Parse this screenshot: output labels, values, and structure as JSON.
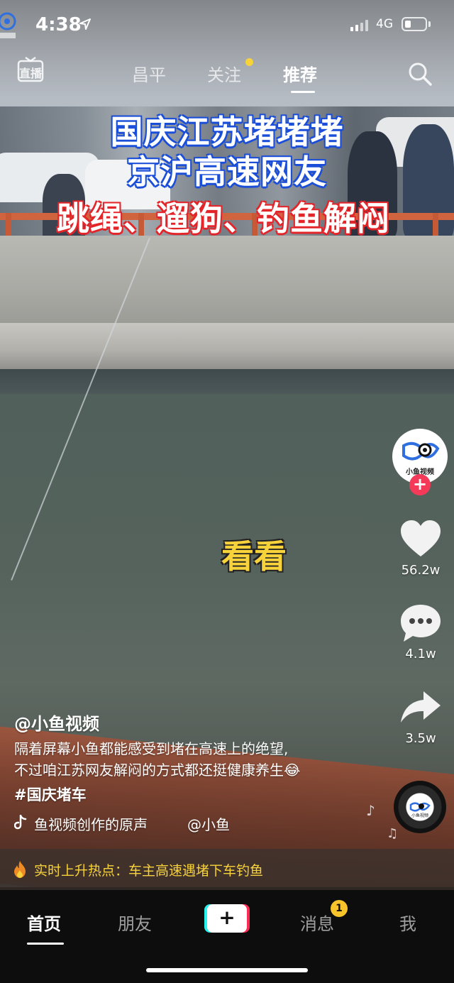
{
  "status_bar": {
    "time": "4:38",
    "network": "4G"
  },
  "watermark": {
    "text": "小鱼视频"
  },
  "top_nav": {
    "live_label": "直播",
    "items": [
      {
        "label": "昌平"
      },
      {
        "label": "关注"
      },
      {
        "label": "推荐"
      }
    ],
    "active": "推荐"
  },
  "video": {
    "title_line1": "国庆江苏堵堵堵",
    "title_line2": "京沪高速网友",
    "title_line3": "跳绳、遛狗、钓鱼解闷",
    "overlay_text": "看看"
  },
  "right_rail": {
    "avatar_text": "小鱼视频",
    "likes": "56.2w",
    "comments": "4.1w",
    "shares": "3.5w"
  },
  "caption": {
    "author": "@小鱼视频",
    "desc_line1": "隔着屏幕小鱼都能感受到堵在高速上的绝望,",
    "desc_line2": "不过咱江苏网友解闷的方式都还挺健康养生😂",
    "hashtag": "#国庆堵车",
    "music_title": "鱼视频创作的原声",
    "music_author": "@小鱼"
  },
  "hot_banner": {
    "text": "实时上升热点：车主高速遇堵下车钓鱼"
  },
  "tab_bar": {
    "items": [
      {
        "label": "首页"
      },
      {
        "label": "朋友"
      },
      {
        "label": "+"
      },
      {
        "label": "消息"
      },
      {
        "label": "我"
      }
    ],
    "messages_badge": "1",
    "active": "首页"
  },
  "colors": {
    "accent_yellow": "#f7d23b",
    "follow_red": "#f43a58",
    "tiktok_cyan": "#25f4ee",
    "tiktok_pink": "#fe2c55",
    "title_blue": "#1b4fd8",
    "title_red": "#e3262b"
  }
}
